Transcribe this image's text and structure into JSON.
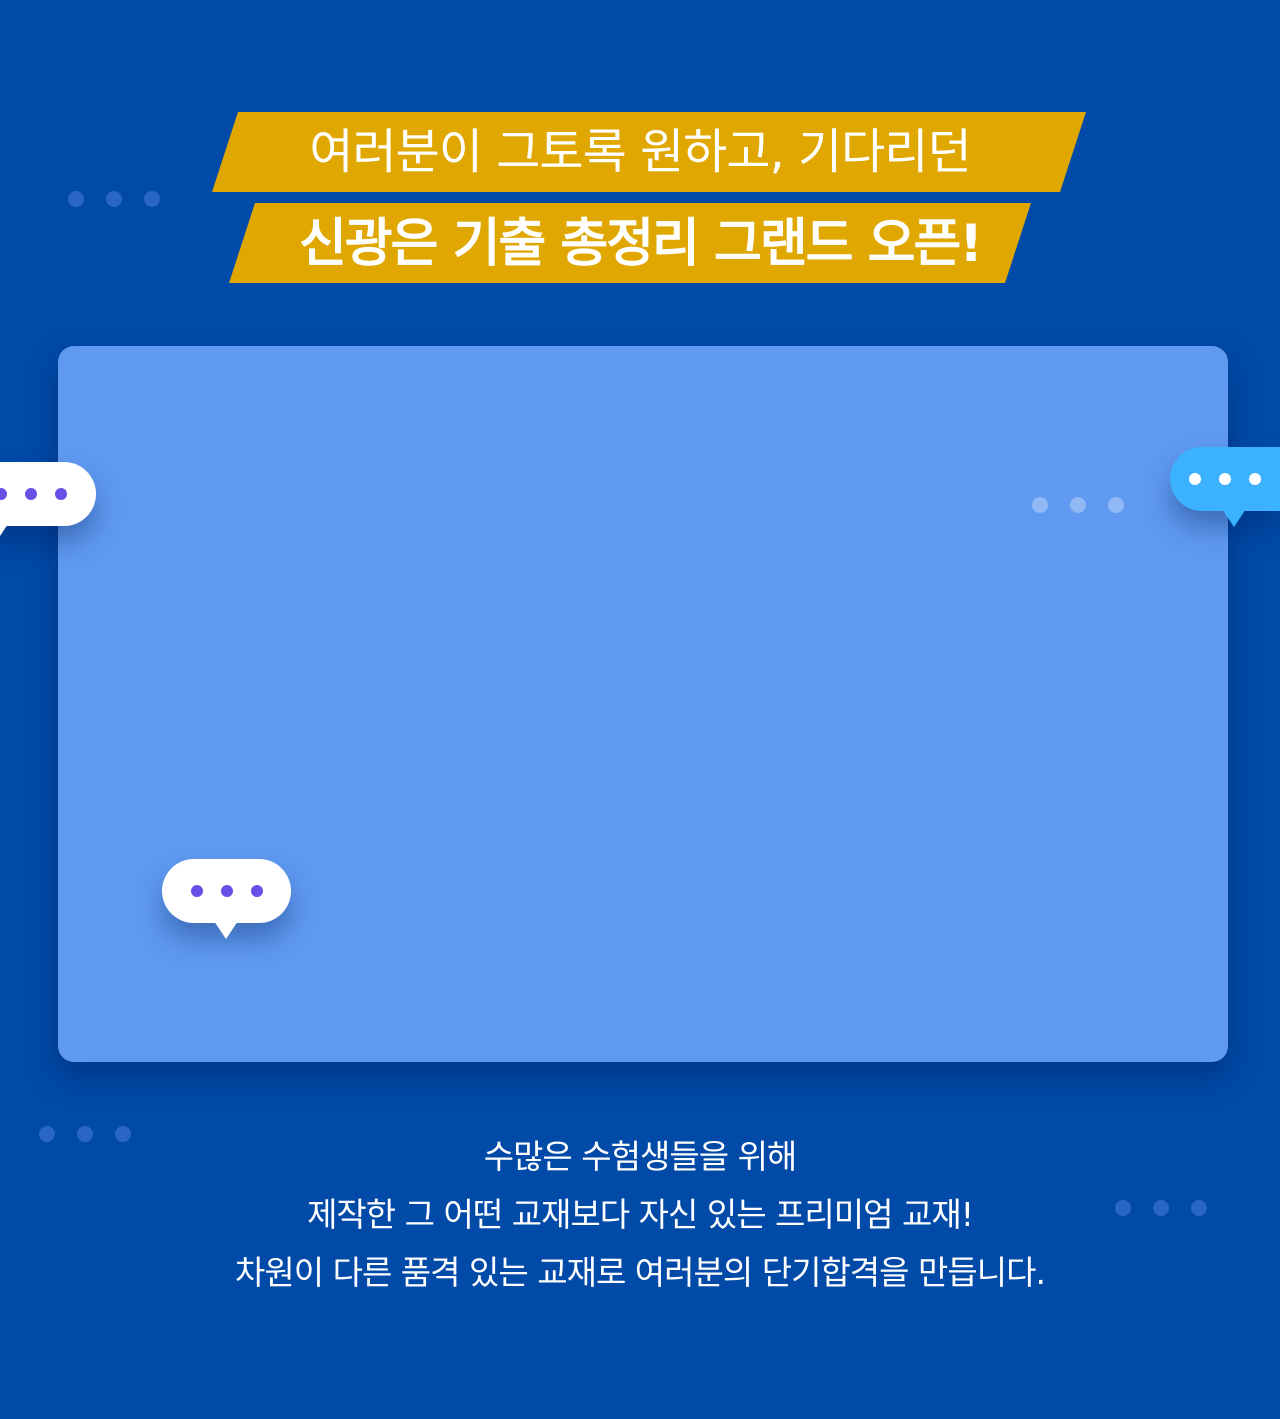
{
  "headline": {
    "line1": "여러분이 그토록 원하고, 기다리던",
    "line2": "신광은 기출 총정리 그랜드 오픈!"
  },
  "description": {
    "line1": "수많은 수험생들을 위해",
    "line2": "제작한 그 어떤 교재보다 자신 있는 프리미엄 교재!",
    "line3": "차원이 다른 품격 있는 교재로 여러분의 단기합격을 만듭니다."
  },
  "colors": {
    "background": "#014aa8",
    "banner": "#e0a700",
    "panel": "#5f9af0",
    "bubble_white": "#ffffff",
    "bubble_cyan": "#3cb1ff",
    "bubble_dot": "#6a4fe6"
  },
  "icons": {
    "chat_bubble": "chat-bubble-icon",
    "ellipsis": "ellipsis-dots-icon"
  }
}
